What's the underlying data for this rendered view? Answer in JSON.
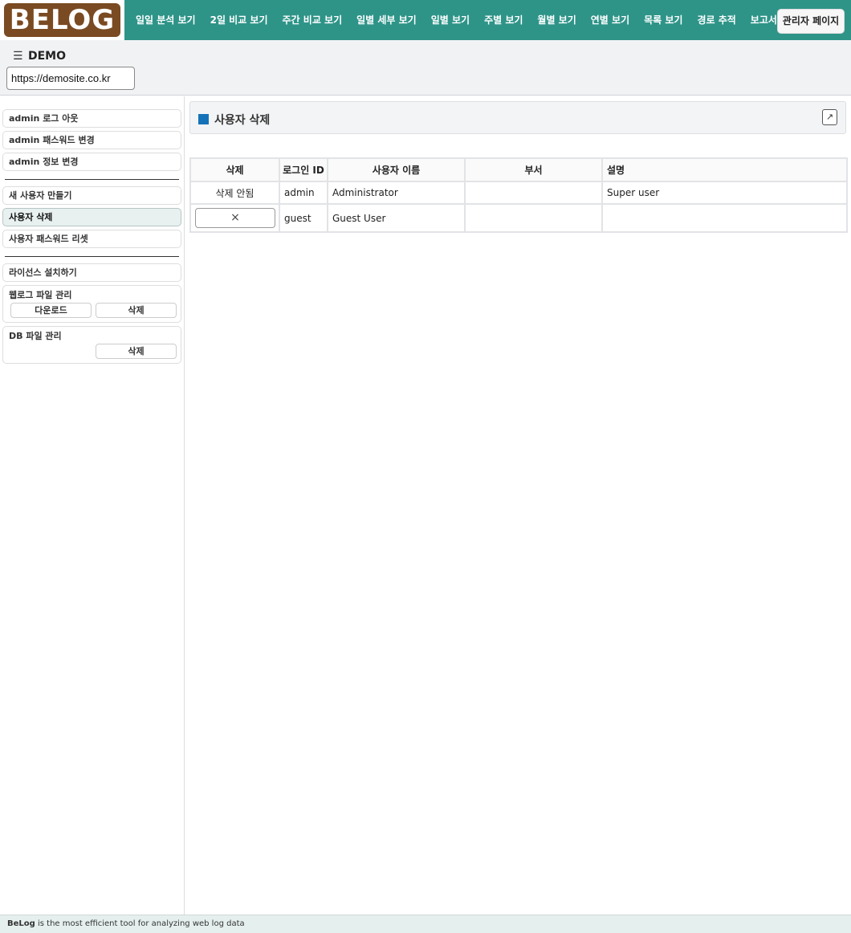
{
  "brand": {
    "logo_text": "BELOG"
  },
  "nav": {
    "items": [
      "일일 분석 보기",
      "2일 비교 보기",
      "주간 비교 보기",
      "일별 세부 보기",
      "일별 보기",
      "주별 보기",
      "월별 보기",
      "연별 보기",
      "목록 보기",
      "경로 추적",
      "보고서"
    ],
    "admin_label": "관리자 페이지"
  },
  "site": {
    "name": "DEMO",
    "url": "https://demosite.co.kr",
    "menu_icon": "☰"
  },
  "sidebar": {
    "logout": "admin 로그 아웃",
    "change_password": "admin 패스워드 변경",
    "change_info": "admin 정보 변경",
    "new_user": "새 사용자 만들기",
    "delete_user": "사용자 삭제",
    "reset_password": "사용자 패스워드 리셋",
    "install_license": "라이선스 설치하기",
    "weblog": {
      "title": "웹로그 파일 관리",
      "download": "다운로드",
      "delete": "삭제"
    },
    "db": {
      "title": "DB 파일 관리",
      "delete": "삭제"
    }
  },
  "main": {
    "title": "사용자 삭제",
    "popout_icon": "↗",
    "table": {
      "headers": [
        "삭제",
        "로그인 ID",
        "사용자 이름",
        "부서",
        "설명"
      ],
      "rows": [
        {
          "action": "삭제 안됨",
          "login_id": "admin",
          "name": "Administrator",
          "dept": "",
          "desc": "Super user"
        },
        {
          "action_icon": "×",
          "login_id": "guest",
          "name": "Guest User",
          "dept": "",
          "desc": ""
        }
      ]
    }
  },
  "footer": {
    "brand": "BeLog",
    "text": " is the most efficient tool for analyzing web log data"
  },
  "colors": {
    "nav_bg": "#2e9488",
    "logo_bg": "#7a4a22",
    "accent_square": "#1473b8",
    "footer_bg": "#e5f0ee"
  }
}
